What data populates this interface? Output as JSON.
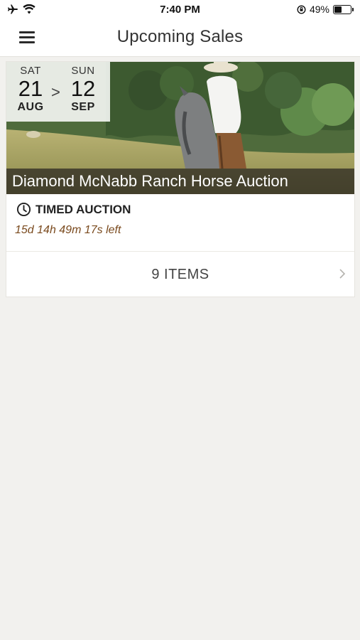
{
  "status_bar": {
    "time": "7:40 PM",
    "battery_percent": "49%",
    "battery_level": 0.49,
    "icons": [
      "airplane-icon",
      "wifi-icon",
      "orientation-lock-icon",
      "battery-icon"
    ]
  },
  "nav": {
    "title": "Upcoming Sales",
    "menu_icon": "hamburger-menu-icon"
  },
  "sale": {
    "start": {
      "dow": "SAT",
      "day": "21",
      "month": "AUG"
    },
    "separator": ">",
    "end": {
      "dow": "SUN",
      "day": "12",
      "month": "SEP"
    },
    "title": "Diamond McNabb Ranch Horse Auction",
    "type": "TIMED AUCTION",
    "type_icon": "clock-icon",
    "time_left": "15d 14h 49m 17s left",
    "items_label": "9 ITEMS",
    "items_icon": "chevron-right-icon"
  },
  "colors": {
    "background": "#f2f1ee",
    "time_left": "#7a4a1e",
    "title_bar": "#28241f"
  }
}
